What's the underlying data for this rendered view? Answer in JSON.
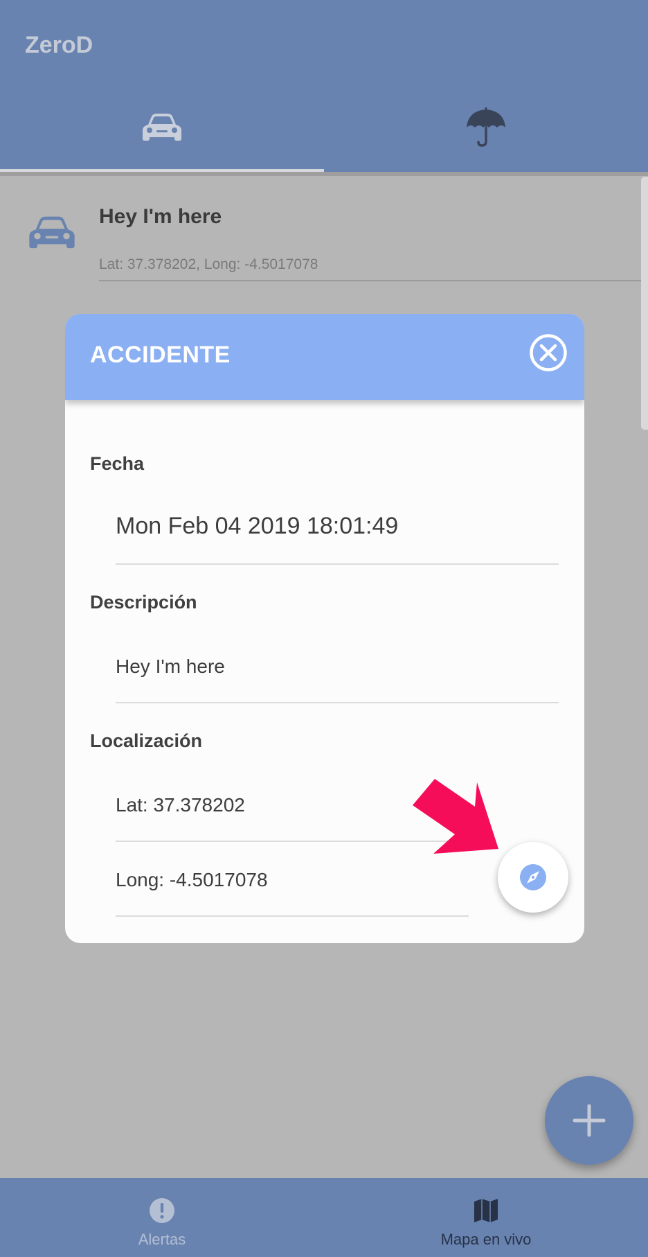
{
  "app": {
    "title": "ZeroD"
  },
  "tabs": [
    {
      "icon": "car-icon",
      "selected": true
    },
    {
      "icon": "umbrella-icon",
      "selected": false
    }
  ],
  "list": {
    "items": [
      {
        "icon": "car-icon",
        "title": "Hey I'm here",
        "subtitle": "Lat: 37.378202, Long: -4.5017078"
      }
    ]
  },
  "dialog": {
    "title": "ACCIDENTE",
    "close_icon": "close-circle-icon",
    "date_label": "Fecha",
    "date_value": "Mon Feb 04 2019 18:01:49",
    "description_label": "Descripción",
    "description_value": "Hey I'm here",
    "location_label": "Localización",
    "lat_value": "Lat: 37.378202",
    "long_value": "Long: -4.5017078",
    "navigate_icon": "compass-icon"
  },
  "fab": {
    "icon": "plus-icon"
  },
  "bottom_nav": [
    {
      "label": "Alertas",
      "icon": "alert-icon",
      "active": false
    },
    {
      "label": "Mapa en vivo",
      "icon": "map-icon",
      "active": true
    }
  ],
  "colors": {
    "primary": "#6983b0",
    "dialog_header": "#8aaff2",
    "annotation_arrow": "#f50d5a",
    "overlay": "#b6b6b6"
  }
}
